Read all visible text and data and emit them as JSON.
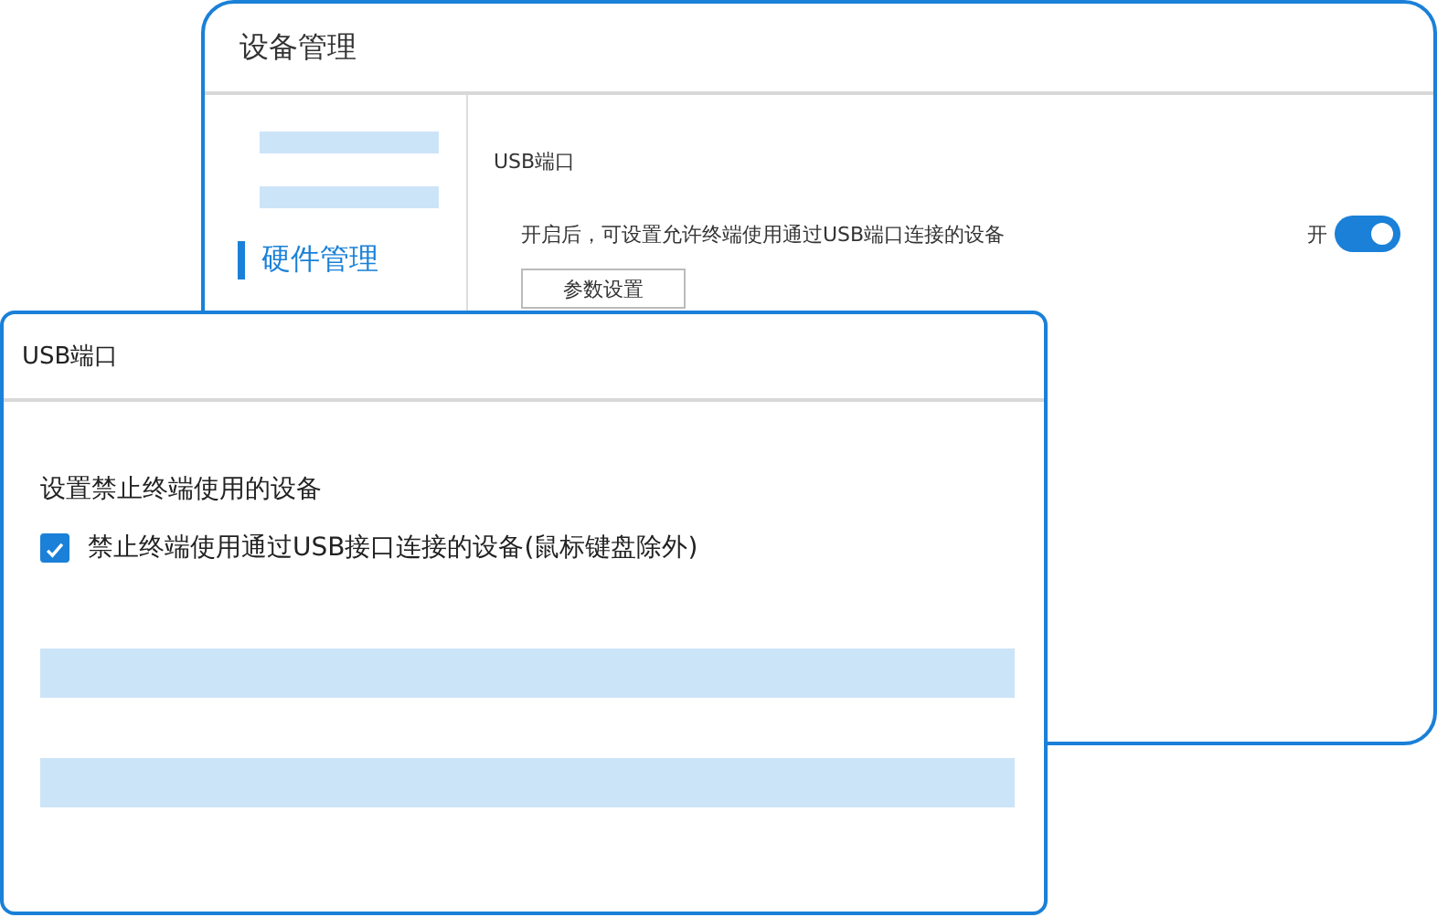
{
  "main_window": {
    "title": "设备管理",
    "sidebar": {
      "items": [
        {
          "kind": "placeholder"
        },
        {
          "kind": "placeholder"
        },
        {
          "kind": "item",
          "label": "硬件管理",
          "selected": true
        }
      ]
    },
    "section_title": "USB端口",
    "setting": {
      "description": "开启后，可设置允许终端使用通过USB端口连接的设备",
      "switch_label": "开",
      "on": true
    },
    "button": "参数设置"
  },
  "dialog": {
    "title": "USB端口",
    "heading": "设置禁止终端使用的设备",
    "checkbox": {
      "label": "禁止终端使用通过USB接口连接的设备(鼠标键盘除外)",
      "checked": true
    },
    "bars": [
      {
        "kind": "placeholder"
      },
      {
        "kind": "placeholder"
      }
    ]
  }
}
